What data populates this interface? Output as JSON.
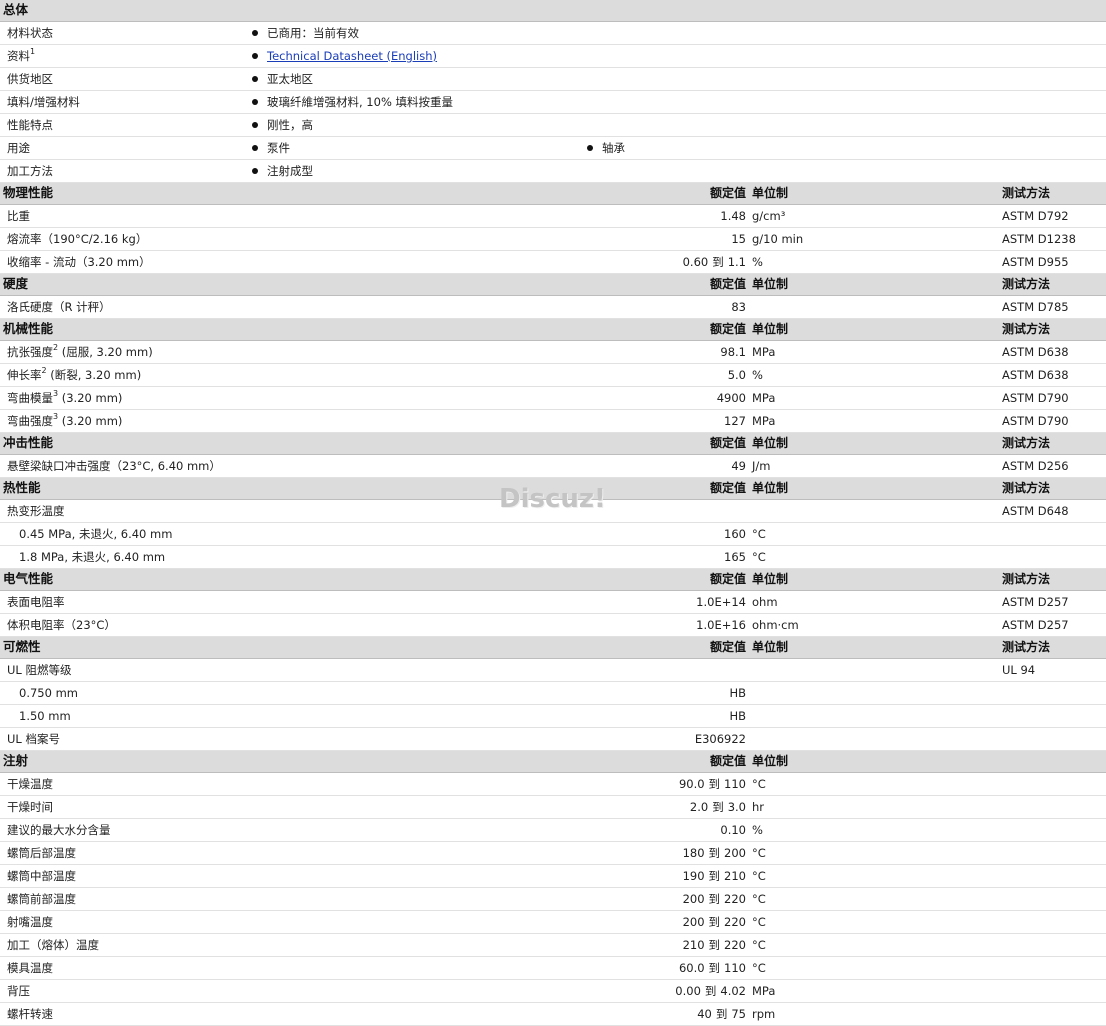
{
  "general": {
    "title": "总体",
    "rows": [
      {
        "label": "材料状态",
        "items": [
          "已商用：当前有效"
        ]
      },
      {
        "label": "资料",
        "sup": "1",
        "items": [
          "Technical Datasheet (English)"
        ],
        "link": true
      },
      {
        "label": "供货地区",
        "items": [
          "亚太地区"
        ]
      },
      {
        "label": "填料/增强材料",
        "items": [
          "玻璃纤維增强材料, 10% 填料按重量"
        ]
      },
      {
        "label": "性能特点",
        "items": [
          "刚性，高"
        ]
      },
      {
        "label": "用途",
        "items": [
          "泵件",
          "轴承"
        ]
      },
      {
        "label": "加工方法",
        "items": [
          "注射成型"
        ]
      }
    ]
  },
  "headers": {
    "nominal": "额定值",
    "unit": "单位制",
    "test": "测试方法"
  },
  "sections": [
    {
      "title": "物理性能",
      "show_test": true,
      "rows": [
        {
          "label": "比重",
          "value": "1.48",
          "unit": "g/cm³",
          "test": "ASTM D792"
        },
        {
          "label": "熔流率（190°C/2.16 kg）",
          "value": "15",
          "unit": "g/10 min",
          "test": "ASTM D1238"
        },
        {
          "label": "收缩率 - 流动（3.20 mm）",
          "v1": "0.60",
          "to": "到",
          "v2": "1.1",
          "unit": "%",
          "test": "ASTM D955"
        }
      ]
    },
    {
      "title": "硬度",
      "show_test": true,
      "rows": [
        {
          "label": "洛氏硬度（R 计秤）",
          "value": "83",
          "unit": "",
          "test": "ASTM D785"
        }
      ]
    },
    {
      "title": "机械性能",
      "show_test": true,
      "rows": [
        {
          "label": "抗张强度",
          "sup": "2",
          "label2": " (屈服, 3.20 mm)",
          "value": "98.1",
          "unit": "MPa",
          "test": "ASTM D638"
        },
        {
          "label": "伸长率",
          "sup": "2",
          "label2": " (断裂, 3.20 mm)",
          "value": "5.0",
          "unit": "%",
          "test": "ASTM D638"
        },
        {
          "label": "弯曲模量",
          "sup": "3",
          "label2": " (3.20 mm)",
          "value": "4900",
          "unit": "MPa",
          "test": "ASTM D790"
        },
        {
          "label": "弯曲强度",
          "sup": "3",
          "label2": " (3.20 mm)",
          "value": "127",
          "unit": "MPa",
          "test": "ASTM D790"
        }
      ]
    },
    {
      "title": "冲击性能",
      "show_test": true,
      "rows": [
        {
          "label": "悬壁梁缺口冲击强度（23°C, 6.40 mm）",
          "value": "49",
          "unit": "J/m",
          "test": "ASTM D256"
        }
      ]
    },
    {
      "title": "热性能",
      "show_test": true,
      "rows": [
        {
          "label": "热变形温度",
          "value": "",
          "unit": "",
          "test": "ASTM D648"
        },
        {
          "label": "0.45 MPa, 未退火, 6.40 mm",
          "indent": true,
          "value": "160",
          "unit": "°C",
          "test": ""
        },
        {
          "label": "1.8 MPa, 未退火, 6.40 mm",
          "indent": true,
          "value": "165",
          "unit": "°C",
          "test": ""
        }
      ]
    },
    {
      "title": "电气性能",
      "show_test": true,
      "rows": [
        {
          "label": "表面电阻率",
          "value": "1.0E+14",
          "unit": "ohm",
          "test": "ASTM D257"
        },
        {
          "label": "体积电阻率（23°C）",
          "value": "1.0E+16",
          "unit": "ohm·cm",
          "test": "ASTM D257"
        }
      ]
    },
    {
      "title": "可燃性",
      "show_test": true,
      "rows": [
        {
          "label": "UL 阻燃等级",
          "value": "",
          "unit": "",
          "test": "UL 94"
        },
        {
          "label": "0.750 mm",
          "indent": true,
          "value": "HB",
          "unit": "",
          "test": ""
        },
        {
          "label": "1.50 mm",
          "indent": true,
          "value": "HB",
          "unit": "",
          "test": ""
        },
        {
          "label": "UL 档案号",
          "value": "E306922",
          "unit": "",
          "test": ""
        }
      ]
    },
    {
      "title": "注射",
      "show_test": false,
      "rows": [
        {
          "label": "干燥温度",
          "v1": "90.0",
          "to": "到",
          "v2": "110",
          "unit": "°C",
          "test": ""
        },
        {
          "label": "干燥时间",
          "v1": "2.0",
          "to": "到",
          "v2": "3.0",
          "unit": "hr",
          "test": ""
        },
        {
          "label": "建议的最大水分含量",
          "value": "0.10",
          "unit": "%",
          "test": ""
        },
        {
          "label": "螺筒后部温度",
          "v1": "180",
          "to": "到",
          "v2": "200",
          "unit": "°C",
          "test": ""
        },
        {
          "label": "螺筒中部温度",
          "v1": "190",
          "to": "到",
          "v2": "210",
          "unit": "°C",
          "test": ""
        },
        {
          "label": "螺筒前部温度",
          "v1": "200",
          "to": "到",
          "v2": "220",
          "unit": "°C",
          "test": ""
        },
        {
          "label": "射嘴温度",
          "v1": "200",
          "to": "到",
          "v2": "220",
          "unit": "°C",
          "test": ""
        },
        {
          "label": "加工（熔体）温度",
          "v1": "210",
          "to": "到",
          "v2": "220",
          "unit": "°C",
          "test": ""
        },
        {
          "label": "模具温度",
          "v1": "60.0",
          "to": "到",
          "v2": "110",
          "unit": "°C",
          "test": ""
        },
        {
          "label": "背压",
          "v1": "0.00",
          "to": "到",
          "v2": "4.02",
          "unit": "MPa",
          "test": ""
        },
        {
          "label": "螺杆转速",
          "v1": "40",
          "to": "到",
          "v2": "75",
          "unit": "rpm",
          "test": ""
        }
      ]
    }
  ],
  "watermark": "Discuz!"
}
